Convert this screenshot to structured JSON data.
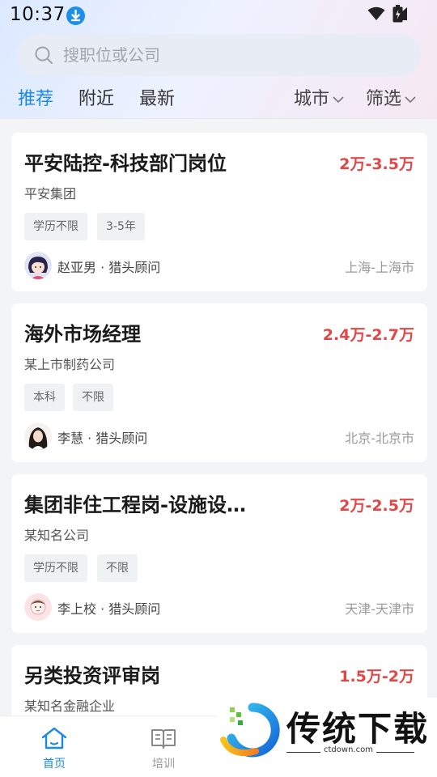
{
  "status": {
    "time": "10:37"
  },
  "search": {
    "placeholder": "搜职位或公司"
  },
  "tabs": [
    {
      "label": "推荐",
      "active": true
    },
    {
      "label": "附近",
      "active": false
    },
    {
      "label": "最新",
      "active": false
    }
  ],
  "filters": {
    "city": "城市",
    "screen": "筛选"
  },
  "jobs": [
    {
      "title": "平安陆控-科技部门岗位",
      "salary": "2万-3.5万",
      "company": "平安集团",
      "tags": [
        "学历不限",
        "3-5年"
      ],
      "recruiter": "赵亚男 · 猎头顾问",
      "location": "上海-上海市"
    },
    {
      "title": "海外市场经理",
      "salary": "2.4万-2.7万",
      "company": "某上市制药公司",
      "tags": [
        "本科",
        "不限"
      ],
      "recruiter": "李慧 · 猎头顾问",
      "location": "北京-北京市"
    },
    {
      "title": "集团非住工程岗-设施设…",
      "salary": "2万-2.5万",
      "company": "某知名公司",
      "tags": [
        "学历不限",
        "不限"
      ],
      "recruiter": "李上校 · 猎头顾问",
      "location": "天津-天津市"
    },
    {
      "title": "另类投资评审岗",
      "salary": "1.5万-2万",
      "company": "某知名金融企业"
    }
  ],
  "bottom_nav": [
    {
      "label": "首页",
      "icon": "home-icon",
      "active": true
    },
    {
      "label": "培训",
      "icon": "book-icon",
      "active": false
    }
  ],
  "watermark": {
    "text": "传统下载",
    "url": "ctdown.com"
  },
  "colors": {
    "accent": "#1e88e5",
    "salary": "#e04848"
  }
}
